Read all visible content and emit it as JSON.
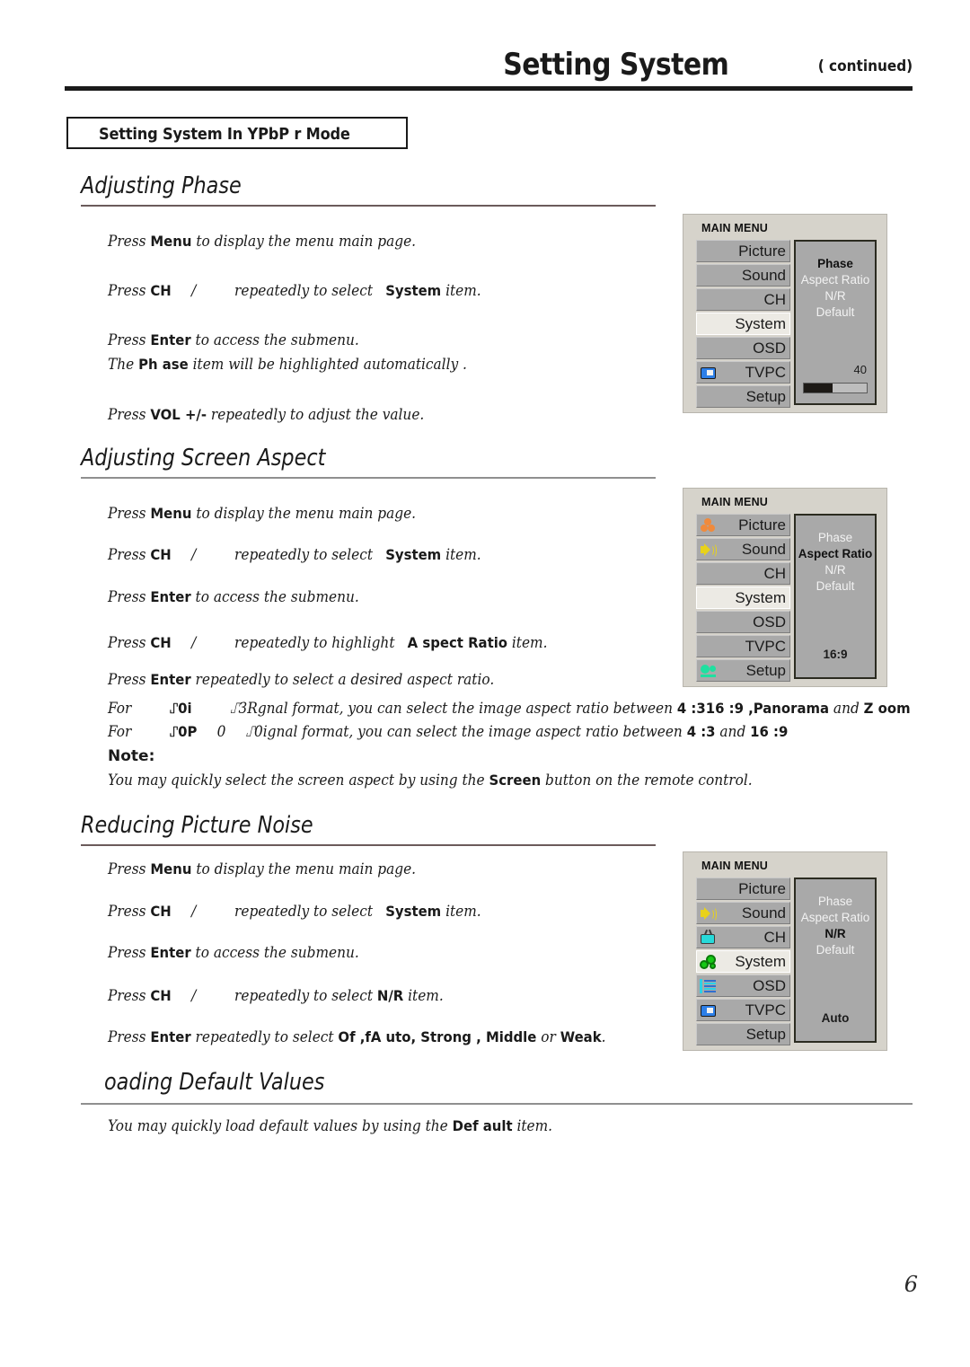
{
  "header": {
    "title": "Setting System",
    "continued": "( continued)"
  },
  "boxed_title": "Setting System In YPbP  r Mode",
  "page_number": "6",
  "note_label": "Note:",
  "sections": [
    {
      "heading": "Adjusting Phase",
      "lines": [
        {
          "a": "Press ",
          "b1": "Menu",
          "c": " to display the menu main page."
        },
        {
          "a": "Press ",
          "b1": "CH",
          "mid": "/",
          "c": "repeatedly to select ",
          "b2": "System",
          "d": " item."
        },
        {
          "a": "Press ",
          "b1": "Enter",
          "c": " to access the submenu."
        },
        {
          "a": "The ",
          "b1": "Ph  ase",
          "c": " item will be highlighted automatically  ."
        },
        {
          "a": "Press ",
          "b1": "VOL +/-",
          "c": " repeatedly to adjust the value."
        }
      ]
    },
    {
      "heading": "Adjusting Screen Aspect",
      "lines": [
        {
          "a": "Press ",
          "b1": "Menu",
          "c": " to display the menu main page."
        },
        {
          "a": "Press ",
          "b1": "CH",
          "mid": "/",
          "c": "repeatedly to select ",
          "b2": "System",
          "d": " item."
        },
        {
          "a": "Press ",
          "b1": "Enter",
          "c": " to access the submenu."
        },
        {
          "a": "Press ",
          "b1": "CH",
          "mid": "/",
          "c": "repeatedly to highlight ",
          "b2": "A spect Ratio",
          "d": " item."
        },
        {
          "a": "Press ",
          "b1": "Enter",
          "c": " repeatedly to select a desired aspect ratio."
        }
      ],
      "for_lines": [
        {
          "lead": "For",
          "fmt1": "⑀0i",
          "fmt2": "⑀3Rgnal format, you can select the image aspect ratio between ",
          "ratios": "4 :3",
          "ratios2": "16 :9 ,",
          "bold1": "Panorama",
          "mid": " and ",
          "bold2": "Z oom"
        },
        {
          "lead": "For",
          "fmt1": "⑀0P",
          "fmt15": "0",
          "fmt2": "⑀0ignal format, you can select the image aspect ratio between ",
          "ratios": "4 :3",
          "mid": " and ",
          "bold2": "16 :9"
        }
      ],
      "note_text_a": "You may quickly select the screen aspect by using the ",
      "note_bold": "Screen",
      "note_text_b": " button on the remote  control."
    },
    {
      "heading": "Reducing Picture Noise",
      "lines": [
        {
          "a": "Press ",
          "b1": "Menu",
          "c": " to display the menu main page."
        },
        {
          "a": "Press ",
          "b1": "CH",
          "mid": "/",
          "c": "repeatedly to select ",
          "b2": "System",
          "d": " item."
        },
        {
          "a": "Press ",
          "b1": "Enter",
          "c": " to access the submenu."
        },
        {
          "a": "Press ",
          "b1": "CH",
          "mid": "/",
          "c": "repeatedly  to select ",
          "b2": "N/R",
          "d": " item."
        },
        {
          "a": "Press ",
          "b1": "Enter",
          "c": " repeatedly to select  ",
          "b2": "Of ,fA uto, Strong , Middle",
          "d2": " or ",
          "b3": "Weak",
          "d": "."
        }
      ]
    },
    {
      "heading": "oading Default Values",
      "final_a": "You may quickly load default values  by using the ",
      "final_bold": "Def   ault",
      "final_b": " item."
    }
  ],
  "osd_panels": [
    {
      "name": "phase-menu",
      "title": "MAIN MENU",
      "buttons": [
        {
          "label": "Picture",
          "icon": "none",
          "selected": false
        },
        {
          "label": "Sound",
          "icon": "none",
          "selected": false
        },
        {
          "label": "CH",
          "icon": "none",
          "selected": false
        },
        {
          "label": "System",
          "icon": "none",
          "selected": true
        },
        {
          "label": "OSD",
          "icon": "none",
          "selected": false
        },
        {
          "label": "TVPC",
          "icon": "tvpc",
          "selected": false
        },
        {
          "label": "Setup",
          "icon": "none",
          "selected": false
        }
      ],
      "sub_items": [
        {
          "label": "Phase",
          "highlighted": true
        },
        {
          "label": "Aspect Ratio",
          "highlighted": false
        },
        {
          "label": "N/R",
          "highlighted": false
        },
        {
          "label": "Default",
          "highlighted": false
        }
      ],
      "value": "40",
      "value_align": "right",
      "slider": true,
      "slider_percent": 45
    },
    {
      "name": "aspect-menu",
      "title": "MAIN MENU",
      "buttons": [
        {
          "label": "Picture",
          "icon": "picture",
          "selected": false
        },
        {
          "label": "Sound",
          "icon": "sound",
          "selected": false
        },
        {
          "label": "CH",
          "icon": "none",
          "selected": false
        },
        {
          "label": "System",
          "icon": "none",
          "selected": true
        },
        {
          "label": "OSD",
          "icon": "none",
          "selected": false
        },
        {
          "label": "TVPC",
          "icon": "none",
          "selected": false
        },
        {
          "label": "Setup",
          "icon": "setup",
          "selected": false
        }
      ],
      "sub_items": [
        {
          "label": "Phase",
          "highlighted": false
        },
        {
          "label": "Aspect Ratio",
          "highlighted": true
        },
        {
          "label": "N/R",
          "highlighted": false
        },
        {
          "label": "Default",
          "highlighted": false
        }
      ],
      "value": "16:9",
      "value_align": "center",
      "slider": false,
      "slider_percent": 0
    },
    {
      "name": "nr-menu",
      "title": "MAIN MENU",
      "buttons": [
        {
          "label": "Picture",
          "icon": "none",
          "selected": false
        },
        {
          "label": "Sound",
          "icon": "sound",
          "selected": false
        },
        {
          "label": "CH",
          "icon": "ch",
          "selected": false
        },
        {
          "label": "System",
          "icon": "system",
          "selected": true
        },
        {
          "label": "OSD",
          "icon": "osd",
          "selected": false
        },
        {
          "label": "TVPC",
          "icon": "tvpc",
          "selected": false
        },
        {
          "label": "Setup",
          "icon": "none",
          "selected": false
        }
      ],
      "sub_items": [
        {
          "label": "Phase",
          "highlighted": false
        },
        {
          "label": "Aspect Ratio",
          "highlighted": false
        },
        {
          "label": "N/R",
          "highlighted": true
        },
        {
          "label": "Default",
          "highlighted": false
        }
      ],
      "value": "Auto",
      "value_align": "center",
      "slider": false,
      "slider_percent": 0
    }
  ]
}
